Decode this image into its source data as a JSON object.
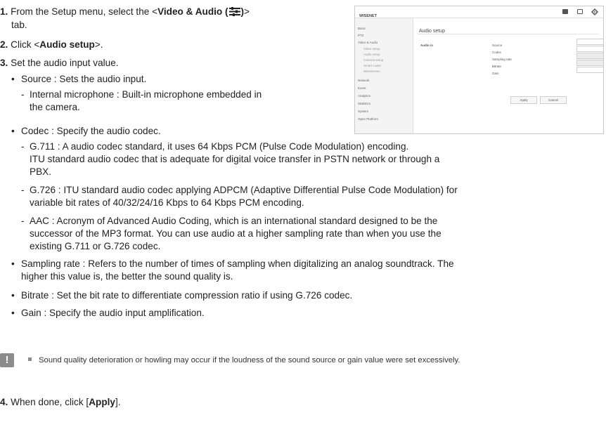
{
  "steps": {
    "s1": {
      "num": "1.",
      "pre": "From the Setup menu, select the <",
      "bold": "Video & Audio (",
      "post_bold": ")",
      "post": ">",
      "line2": "tab."
    },
    "s2": {
      "num": "2.",
      "pre": "Click <",
      "bold": "Audio setup",
      "post": ">."
    },
    "s3": {
      "num": "3.",
      "text": "Set the audio input value."
    },
    "s4": {
      "num": "4.",
      "pre": "When done, click [",
      "bold": "Apply",
      "post": "]."
    }
  },
  "bullets": {
    "source": "Source : Sets the audio input.",
    "source_internal_1": "Internal microphone : Built-in microphone embedded in",
    "source_internal_2": "the camera.",
    "codec": "Codec : Specify the audio codec.",
    "g711_1": "G.711 : A audio codec standard, it uses 64 Kbps PCM (Pulse Code Modulation) encoding.",
    "g711_2": "ITU standard audio codec that is adequate for digital voice transfer in PSTN network or through a",
    "g711_3": "PBX.",
    "g726_1": "G.726 : ITU standard audio codec applying ADPCM (Adaptive Differential Pulse Code Modulation) for",
    "g726_2": "variable bit rates of 40/32/24/16 Kbps to 64 Kbps PCM encoding.",
    "aac_1": "AAC : Acronym of Advanced Audio Coding, which is an international standard designed to be the",
    "aac_2": "successor of the MP3 format. You can use audio at a higher sampling rate than when you use the",
    "aac_3": "existing G.711 or G.726 codec.",
    "sampling_1": "Sampling rate : Refers to the number of times of sampling when digitalizing an analog soundtrack. The",
    "sampling_2": "higher this value is, the better the sound quality is.",
    "bitrate": "Bitrate : Set the bit rate to differentiate compression ratio if using G.726 codec.",
    "gain": "Gain : Specify the audio input amplification."
  },
  "note": {
    "icon": "!",
    "text": "Sound quality deterioration or howling may occur if the loudness of the sound source or gain value were set excessively."
  },
  "screenshot": {
    "logo": "WISENET",
    "title": "Audio setup",
    "group": "Audio in",
    "fields": [
      "Source",
      "Codec",
      "Sampling rate",
      "Bitrate",
      "Gain"
    ],
    "apply": "Apply",
    "cancel": "Cancel",
    "sidebar": [
      "Basic",
      "PTZ",
      "Video & Audio",
      "Video setup",
      "Audio setup",
      "Camera setup",
      "Smart codec",
      "Wisestream",
      "Network",
      "Event",
      "Analytics",
      "Statistics",
      "System",
      "Open Platform"
    ]
  },
  "colors": {
    "icon_gray": "#8c8c8c",
    "text": "#222222"
  }
}
